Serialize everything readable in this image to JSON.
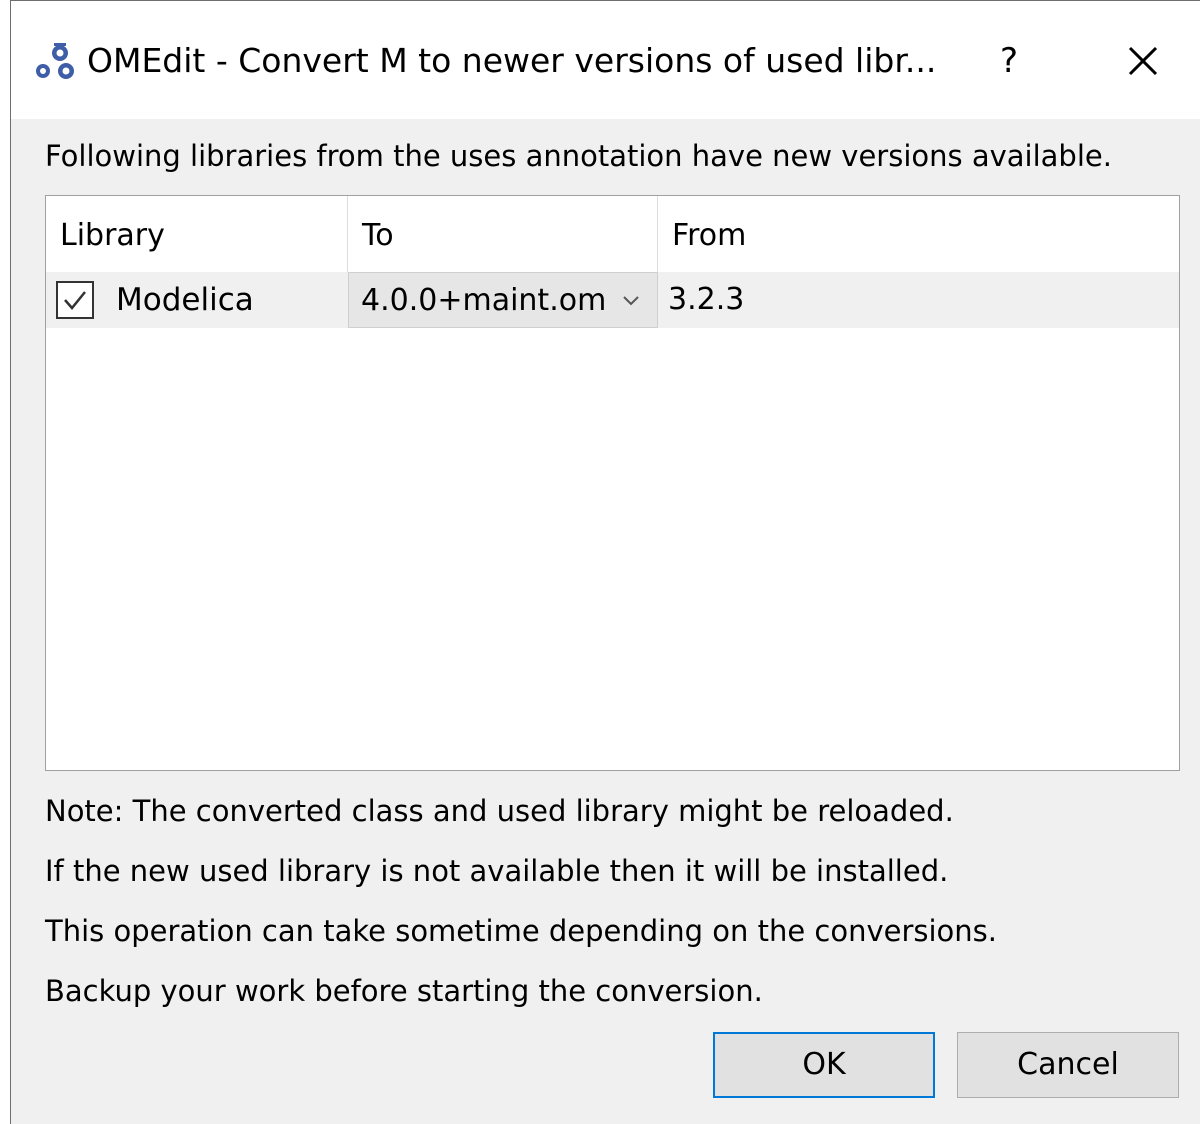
{
  "window": {
    "title": "OMEdit - Convert M to newer versions of used libr...",
    "help_label": "?",
    "app_icon": "omedit-logo-icon",
    "close_icon": "close-icon"
  },
  "intro": "Following libraries from the uses annotation have new versions available.",
  "table": {
    "columns": [
      "Library",
      "To",
      "From"
    ],
    "rows": [
      {
        "checked": true,
        "library": "Modelica",
        "to": "4.0.0+maint.om",
        "from": "3.2.3"
      }
    ]
  },
  "notes": [
    "Note: The converted class and used library might be reloaded.",
    "If the new used library is not available then it will be installed.",
    "This operation can take sometime depending on the conversions.",
    "Backup your work before starting the conversion."
  ],
  "buttons": {
    "ok": "OK",
    "cancel": "Cancel"
  },
  "colors": {
    "focus_border": "#0078d7",
    "dialog_bg": "#f0f0f0",
    "icon_blue": "#3f5ea8"
  }
}
